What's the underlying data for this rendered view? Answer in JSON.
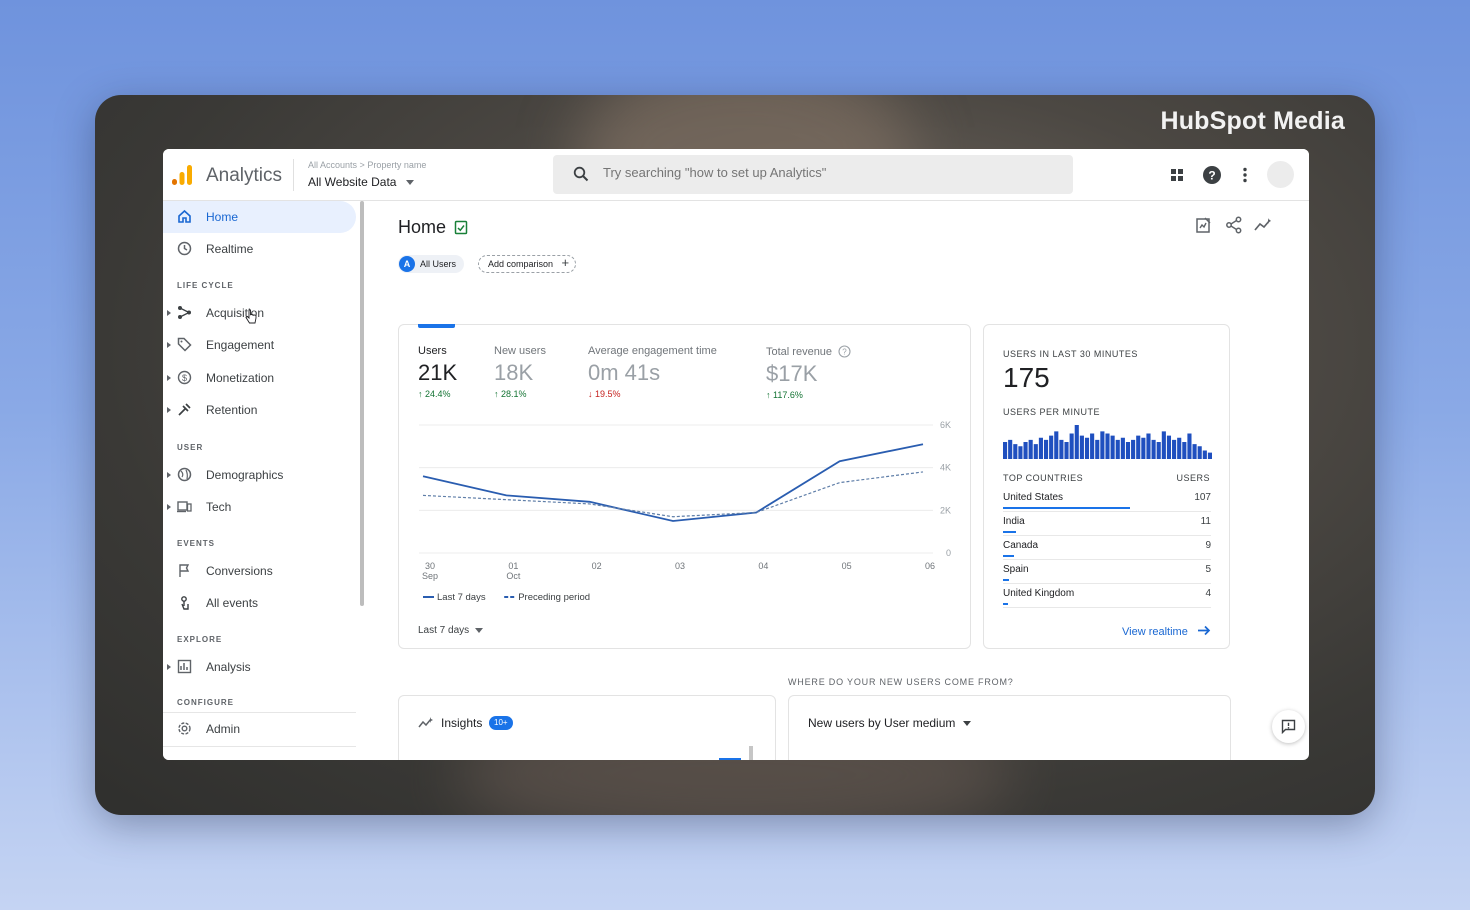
{
  "brand": "HubSpot Media",
  "app": {
    "title": "Analytics",
    "breadcrumb_accounts": "All Accounts",
    "breadcrumb_property": "Property name",
    "property_selected": "All Website Data",
    "search_placeholder": "Try searching \"how to set up Analytics\""
  },
  "colors": {
    "accent": "#1a73e8",
    "active_bg": "#e8f0fe",
    "positive": "#137333",
    "negative": "#c5221f",
    "logo_orange": "#f9ab00",
    "logo_dark": "#e37400"
  },
  "sidebar": {
    "items": [
      {
        "label": "Home",
        "icon": "home-icon"
      },
      {
        "label": "Realtime",
        "icon": "clock-icon"
      },
      {
        "label": "Acquisition",
        "icon": "acquisition-icon"
      },
      {
        "label": "Engagement",
        "icon": "tag-icon"
      },
      {
        "label": "Monetization",
        "icon": "dollar-icon"
      },
      {
        "label": "Retention",
        "icon": "retention-icon"
      },
      {
        "label": "Demographics",
        "icon": "globe-icon"
      },
      {
        "label": "Tech",
        "icon": "devices-icon"
      },
      {
        "label": "Conversions",
        "icon": "flag-icon"
      },
      {
        "label": "All events",
        "icon": "touch-icon"
      },
      {
        "label": "Analysis",
        "icon": "analysis-icon"
      },
      {
        "label": "Admin",
        "icon": "gear-icon"
      }
    ],
    "sections": {
      "lifecycle": "LIFE CYCLE",
      "user": "USER",
      "events": "EVENTS",
      "explore": "EXPLORE",
      "configure": "CONFIGURE"
    }
  },
  "main": {
    "title": "Home",
    "chip_all_users": "All Users",
    "chip_all_users_letter": "A",
    "chip_add_comparison": "Add comparison"
  },
  "metrics": [
    {
      "label": "Users",
      "value": "21K",
      "delta": "24.4%",
      "direction": "up"
    },
    {
      "label": "New users",
      "value": "18K",
      "delta": "28.1%",
      "direction": "up"
    },
    {
      "label": "Average engagement time",
      "value": "0m 41s",
      "delta": "19.5%",
      "direction": "down"
    },
    {
      "label": "Total revenue",
      "value": "$17K",
      "delta": "117.6%",
      "direction": "up"
    }
  ],
  "chart_data": {
    "type": "line",
    "x": [
      "30",
      "01",
      "02",
      "03",
      "04",
      "05",
      "06"
    ],
    "x_sublabels": [
      "Sep",
      "Oct",
      "",
      "",
      "",
      "",
      ""
    ],
    "yticks": [
      "0",
      "2K",
      "4K",
      "6K"
    ],
    "ylim": [
      0,
      6000
    ],
    "series": [
      {
        "name": "Last 7 days",
        "style": "solid",
        "values": [
          3600,
          2700,
          2400,
          1500,
          1900,
          4300,
          5100
        ]
      },
      {
        "name": "Preceding period",
        "style": "dashed",
        "values": [
          2700,
          2500,
          2300,
          1700,
          1900,
          3300,
          3800
        ]
      }
    ],
    "range_selector": "Last 7 days"
  },
  "realtime": {
    "title": "USERS IN LAST 30 MINUTES",
    "value": "175",
    "per_minute_title": "USERS PER MINUTE",
    "per_minute": [
      8,
      9,
      7,
      6,
      8,
      9,
      7,
      10,
      9,
      11,
      13,
      9,
      8,
      12,
      16,
      11,
      10,
      12,
      9,
      13,
      12,
      11,
      9,
      10,
      8,
      9,
      11,
      10,
      12,
      9,
      8,
      13,
      11,
      9,
      10,
      8,
      12,
      7,
      6,
      4,
      3
    ],
    "countries_header": "TOP COUNTRIES",
    "users_header": "USERS",
    "countries": [
      {
        "name": "United States",
        "users": "107",
        "share": 1.0
      },
      {
        "name": "India",
        "users": "11",
        "share": 0.1
      },
      {
        "name": "Canada",
        "users": "9",
        "share": 0.085
      },
      {
        "name": "Spain",
        "users": "5",
        "share": 0.05
      },
      {
        "name": "United Kingdom",
        "users": "4",
        "share": 0.04
      }
    ],
    "view_link": "View realtime"
  },
  "bottom": {
    "section_title": "WHERE DO YOUR NEW USERS COME FROM?",
    "insights_label": "Insights",
    "insights_badge": "10+",
    "new_users_dropdown": "New users by User medium"
  }
}
